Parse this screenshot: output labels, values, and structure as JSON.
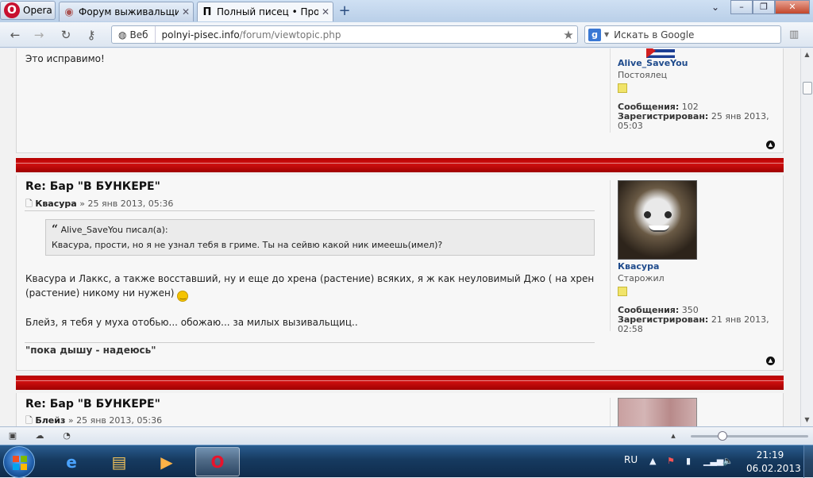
{
  "browser": {
    "menu_label": "Opera",
    "tabs": [
      {
        "title": "Форум выживальщик...",
        "active": false
      },
      {
        "title": "Полный писец • Прос...",
        "active": true
      }
    ],
    "new_tab": "+",
    "address": {
      "security_label": "Веб",
      "host": "polnyi-pisec.info",
      "path": "/forum/viewtopic.php"
    },
    "search_placeholder": "Искать в Google"
  },
  "posts": [
    {
      "text": "Это исправимо!",
      "profile": {
        "username": "Alive_SaveYou",
        "rank": "Постоялец",
        "posts_label": "Сообщения:",
        "posts_count": "102",
        "registered_label": "Зарегистрирован:",
        "registered_date": "25 янв 2013,",
        "registered_time": "05:03"
      }
    },
    {
      "title": "Re: Бар \"В БУНКЕРЕ\"",
      "author": "Квасура",
      "date": "» 25 янв 2013, 05:36",
      "quote_author": "Alive_SaveYou писал(а):",
      "quote_text": "Квасура, прости, но я не узнал тебя в гриме. Ты на сейвю какой ник имеешь(имел)?",
      "paragraph1": "Квасура и Лаккс, а также восставший, ну и еще до хрена (растение) всяких, я ж как неуловимый Джо ( на хрен (растение) никому ни нужен)",
      "paragraph2": "Блейз, я тебя у муха отобью... обожаю... за милых вызивальщиц..",
      "signature": "\"пока дышу - надеюсь\"",
      "profile": {
        "username": "Квасура",
        "rank": "Старожил",
        "posts_label": "Сообщения:",
        "posts_count": "350",
        "registered_label": "Зарегистрирован:",
        "registered_date": "21 янв 2013,",
        "registered_time": "02:58"
      }
    },
    {
      "title": "Re: Бар \"В БУНКЕРЕ\"",
      "author": "Блейз",
      "date": "» 25 янв 2013, 05:36"
    }
  ],
  "taskbar": {
    "lang": "RU",
    "time": "21:19",
    "date": "06.02.2013"
  },
  "colors": {
    "header_red": "#c00000",
    "link_blue": "#1f4b8c",
    "taskbar": "#163a60"
  }
}
